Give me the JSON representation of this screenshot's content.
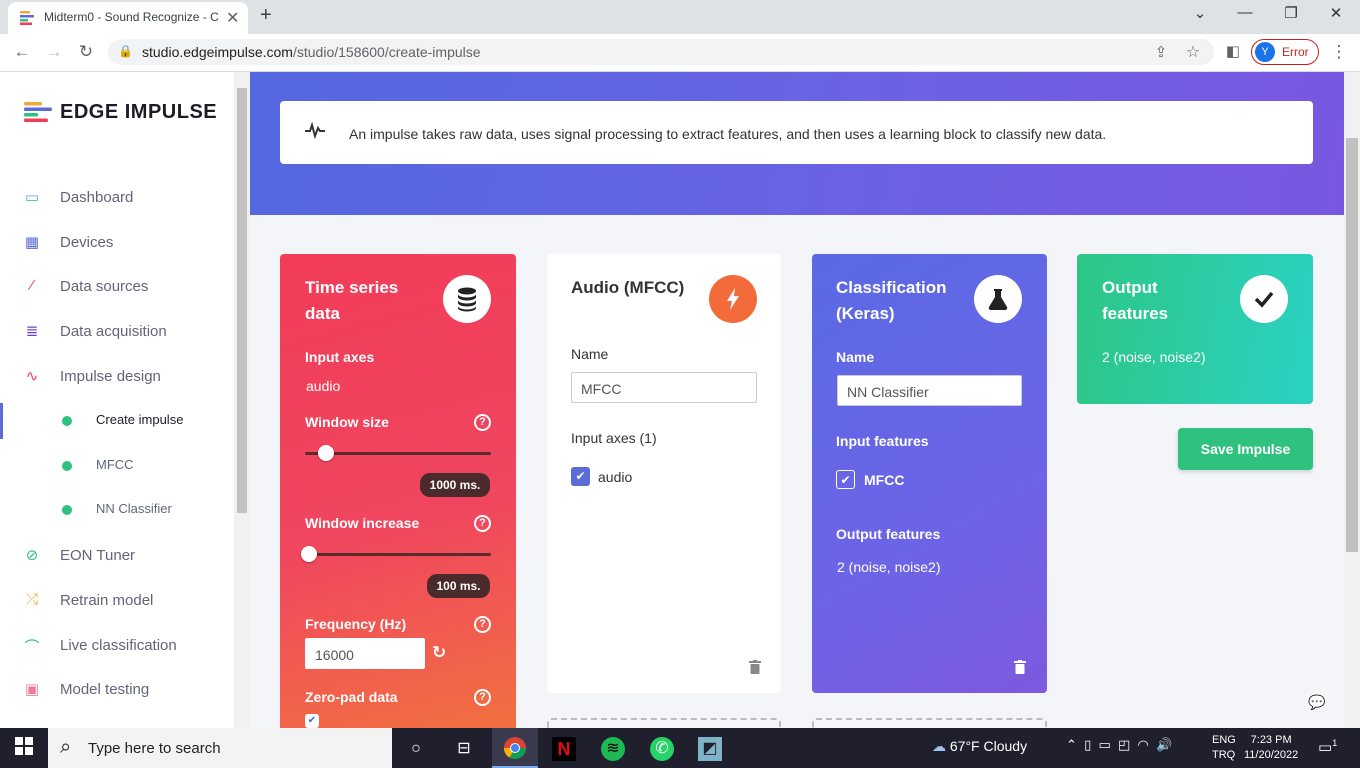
{
  "browser": {
    "tab_title": "Midterm0 - Sound Recognize - C",
    "url_host": "studio.edgeimpulse.com",
    "url_path": "/studio/158600/create-impulse",
    "profile_initial": "Y",
    "profile_status": "Error"
  },
  "sidebar": {
    "brand": "EDGE IMPULSE",
    "items": [
      {
        "label": "Dashboard",
        "icon": "monitor-icon"
      },
      {
        "label": "Devices",
        "icon": "chip-icon"
      },
      {
        "label": "Data sources",
        "icon": "wand-icon"
      },
      {
        "label": "Data acquisition",
        "icon": "database-icon"
      },
      {
        "label": "Impulse design",
        "icon": "pulse-icon"
      }
    ],
    "subitems": [
      {
        "label": "Create impulse",
        "active": true
      },
      {
        "label": "MFCC"
      },
      {
        "label": "NN Classifier"
      }
    ],
    "items2": [
      {
        "label": "EON Tuner",
        "icon": "compass-icon"
      },
      {
        "label": "Retrain model",
        "icon": "shuffle-icon"
      },
      {
        "label": "Live classification",
        "icon": "signal-icon"
      },
      {
        "label": "Model testing",
        "icon": "clipboard-icon"
      }
    ]
  },
  "banner": {
    "text": "An impulse takes raw data, uses signal processing to extract features, and then uses a learning block to classify new data."
  },
  "time_series": {
    "title_line1": "Time series",
    "title_line2": "data",
    "input_axes_label": "Input axes",
    "input_axes_value": "audio",
    "window_size_label": "Window size",
    "window_size_value": "1000 ms.",
    "window_increase_label": "Window increase",
    "window_increase_value": "100 ms.",
    "frequency_label": "Frequency (Hz)",
    "frequency_value": "16000",
    "zero_pad_label": "Zero-pad data",
    "zero_pad_checked": true
  },
  "mfcc": {
    "title": "Audio (MFCC)",
    "name_label": "Name",
    "name_value": "MFCC",
    "input_axes_label": "Input axes (1)",
    "axis": "audio"
  },
  "classification": {
    "title_line1": "Classification",
    "title_line2": "(Keras)",
    "name_label": "Name",
    "name_value": "NN Classifier",
    "input_features_label": "Input features",
    "input_feature": "MFCC",
    "output_features_label": "Output features",
    "output_features_value": "2 (noise, noise2)"
  },
  "output": {
    "title_line1": "Output",
    "title_line2": "features",
    "value": "2 (noise, noise2)"
  },
  "save_button": "Save Impulse",
  "taskbar": {
    "search_placeholder": "Type here to search",
    "weather": "67°F  Cloudy",
    "lang1": "ENG",
    "lang2": "TRQ",
    "time": "7:23 PM",
    "date": "11/20/2022",
    "notif_count": "1"
  },
  "colors": {
    "accent_green": "#2ec27e",
    "orange": "#f26b3a",
    "purple": "#6c64e6"
  }
}
